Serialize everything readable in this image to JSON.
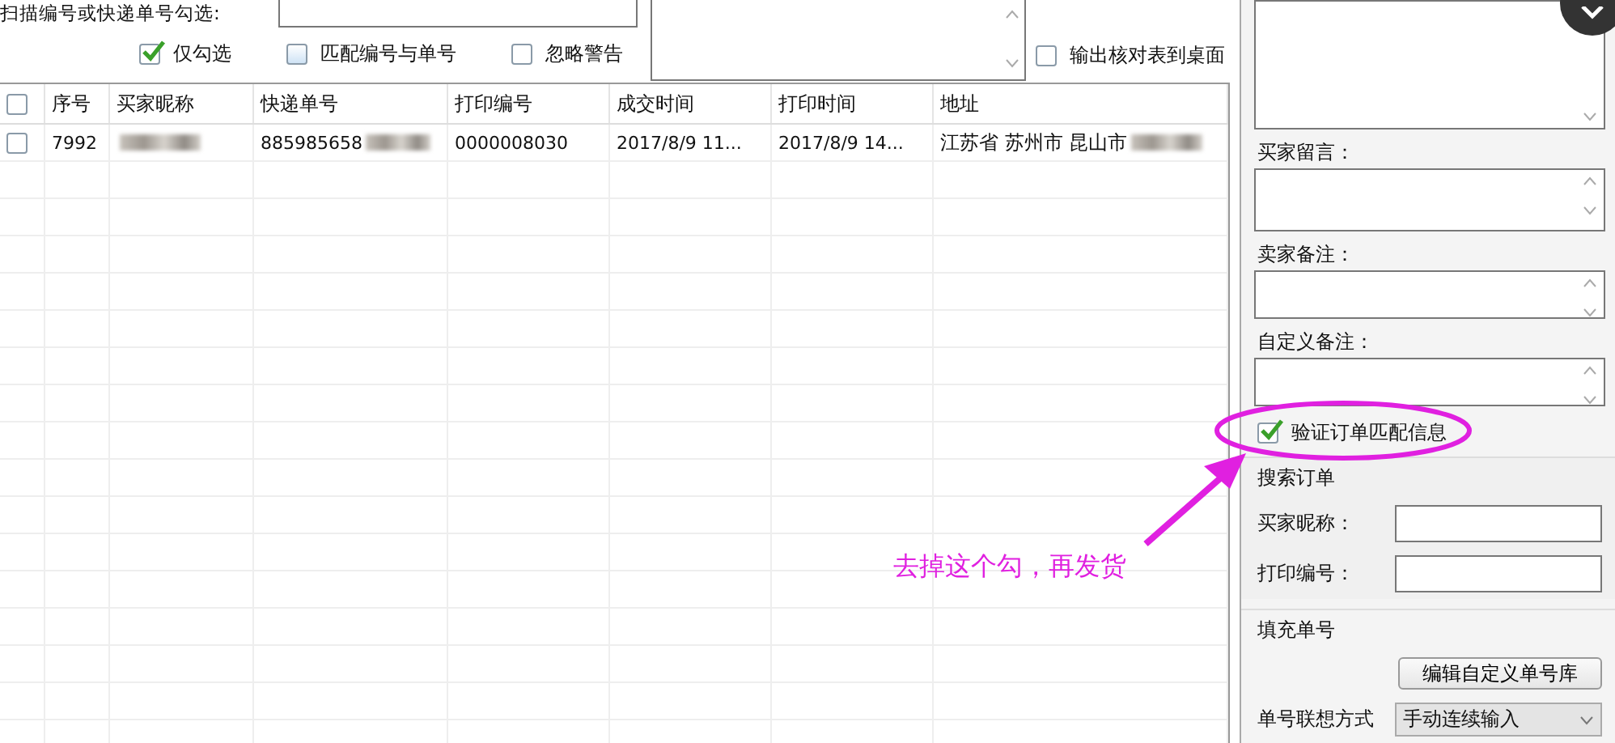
{
  "scan": {
    "label": "扫描编号或快递单号勾选:",
    "options": [
      {
        "label": "仅勾选",
        "checked": true
      },
      {
        "label": "匹配编号与单号",
        "checked": false
      },
      {
        "label": "忽略警告",
        "checked": false
      }
    ],
    "export": {
      "label": "输出核对表到桌面",
      "checked": false
    }
  },
  "table": {
    "header_checked": false,
    "columns": [
      {
        "label": "序号"
      },
      {
        "label": "买家昵称"
      },
      {
        "label": "快递单号"
      },
      {
        "label": "打印编号"
      },
      {
        "label": "成交时间"
      },
      {
        "label": "打印时间"
      },
      {
        "label": "地址"
      }
    ],
    "rows": [
      {
        "checked": false,
        "cells": [
          {
            "text": "7992",
            "redacted": false
          },
          {
            "redacted": true
          },
          {
            "text": "885985658",
            "redacted": true
          },
          {
            "text": "0000008030",
            "redacted": false
          },
          {
            "text": "2017/8/9 11...",
            "redacted": false
          },
          {
            "text": "2017/8/9 14...",
            "redacted": false
          },
          {
            "text": "江苏省 苏州市 昆山市",
            "redacted": true
          }
        ]
      }
    ]
  },
  "side": {
    "notes": [
      {
        "label": "买家留言："
      },
      {
        "label": "卖家备注："
      },
      {
        "label": "自定义备注："
      }
    ],
    "verify": {
      "label": "验证订单匹配信息",
      "checked": true
    },
    "search": {
      "title": "搜索订单",
      "fields": [
        {
          "label": "买家昵称："
        },
        {
          "label": "打印编号："
        }
      ]
    },
    "fill": {
      "title": "填充单号",
      "button": "编辑自定义单号库",
      "select_label": "单号联想方式",
      "select_value": "手动连续输入"
    }
  },
  "annotation": {
    "text": "去掉这个勾，再发货"
  }
}
